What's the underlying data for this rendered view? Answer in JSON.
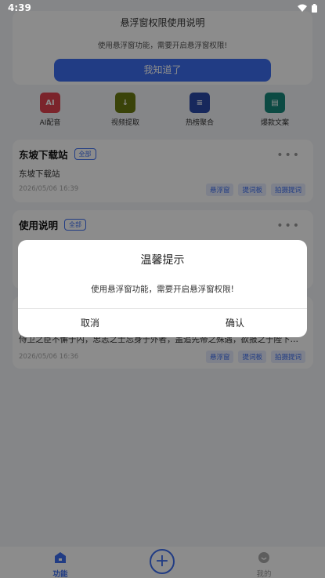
{
  "status_bar": {
    "time": "4:39"
  },
  "permission_banner": {
    "title": "悬浮窗权限使用说明",
    "description": "使用悬浮窗功能，需要开启悬浮窗权限!",
    "button_label": "我知道了"
  },
  "tools": [
    {
      "label": "AI配音",
      "icon": "ai-dub-icon",
      "color": "#e0424f",
      "glyph": "AI"
    },
    {
      "label": "视频提取",
      "icon": "video-extract-icon",
      "color": "#6b7a12",
      "glyph": "↓"
    },
    {
      "label": "热榜聚合",
      "icon": "hot-list-icon",
      "color": "#2b4aa8",
      "glyph": "≡"
    },
    {
      "label": "爆款文案",
      "icon": "copywriting-icon",
      "color": "#16887a",
      "glyph": "▤"
    }
  ],
  "cards": [
    {
      "title": "东坡下载站",
      "tag": "全部",
      "body": "东坡下载站",
      "date": "2026/05/06 16:39",
      "chips": [
        "悬浮窗",
        "提词板",
        "拍摄提词"
      ]
    },
    {
      "title": "使用说明",
      "tag": "全部",
      "body": "",
      "date": "",
      "chips": []
    },
    {
      "title": "",
      "tag": "",
      "body": "侍卫之臣不懈于内，忠志之士忘身于外者，盖追先帝之殊遇，欲报之于陛下…",
      "date": "2026/05/06 16:36",
      "chips": [
        "悬浮窗",
        "提词板",
        "拍摄提词"
      ]
    }
  ],
  "bottom_nav": {
    "left_label": "功能",
    "right_label": "我的",
    "add_symbol": "+",
    "accent": "#3d6ef0"
  },
  "dialog": {
    "title": "温馨提示",
    "message": "使用悬浮窗功能，需要开启悬浮窗权限!",
    "cancel_label": "取消",
    "confirm_label": "确认"
  }
}
